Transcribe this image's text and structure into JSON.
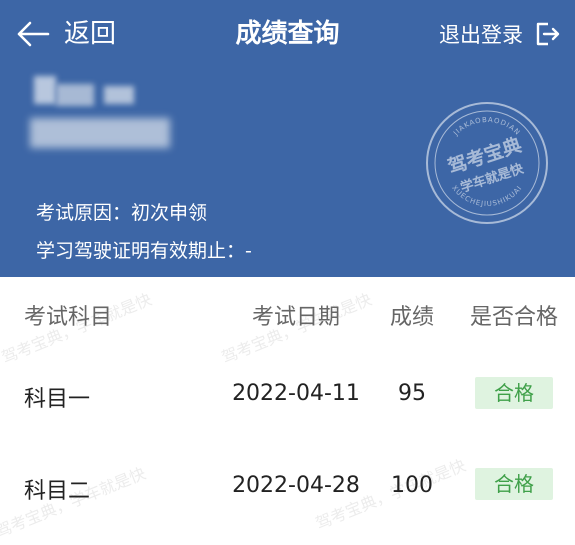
{
  "nav": {
    "back_label": "返回",
    "title": "成绩查询",
    "logout_label": "退出登录"
  },
  "info": {
    "reason": "考试原因：初次申领",
    "validity": "学习驾驶证明有效期止：-"
  },
  "stamp": {
    "top_text": "JIAKAOBAODIAN",
    "main_text": "驾考宝典",
    "sub_text": "学车就是快",
    "bottom_text": "XUECHEJIUSHIKUAI"
  },
  "table": {
    "headers": [
      "考试科目",
      "考试日期",
      "成绩",
      "是否合格"
    ],
    "rows": [
      {
        "subject": "科目一",
        "date": "2022-04-11",
        "score": "95",
        "result": "合格"
      },
      {
        "subject": "科目二",
        "date": "2022-04-28",
        "score": "100",
        "result": "合格"
      }
    ]
  },
  "watermark": [
    "驾考宝典，学车就是快",
    "驾考宝典，学车就是快",
    "驾考宝典，学车就是快",
    "驾考宝典，学车就是快"
  ],
  "colors": {
    "header_bg": "#3d66a6",
    "badge_bg": "#dff3e0",
    "badge_text": "#3fa049"
  }
}
